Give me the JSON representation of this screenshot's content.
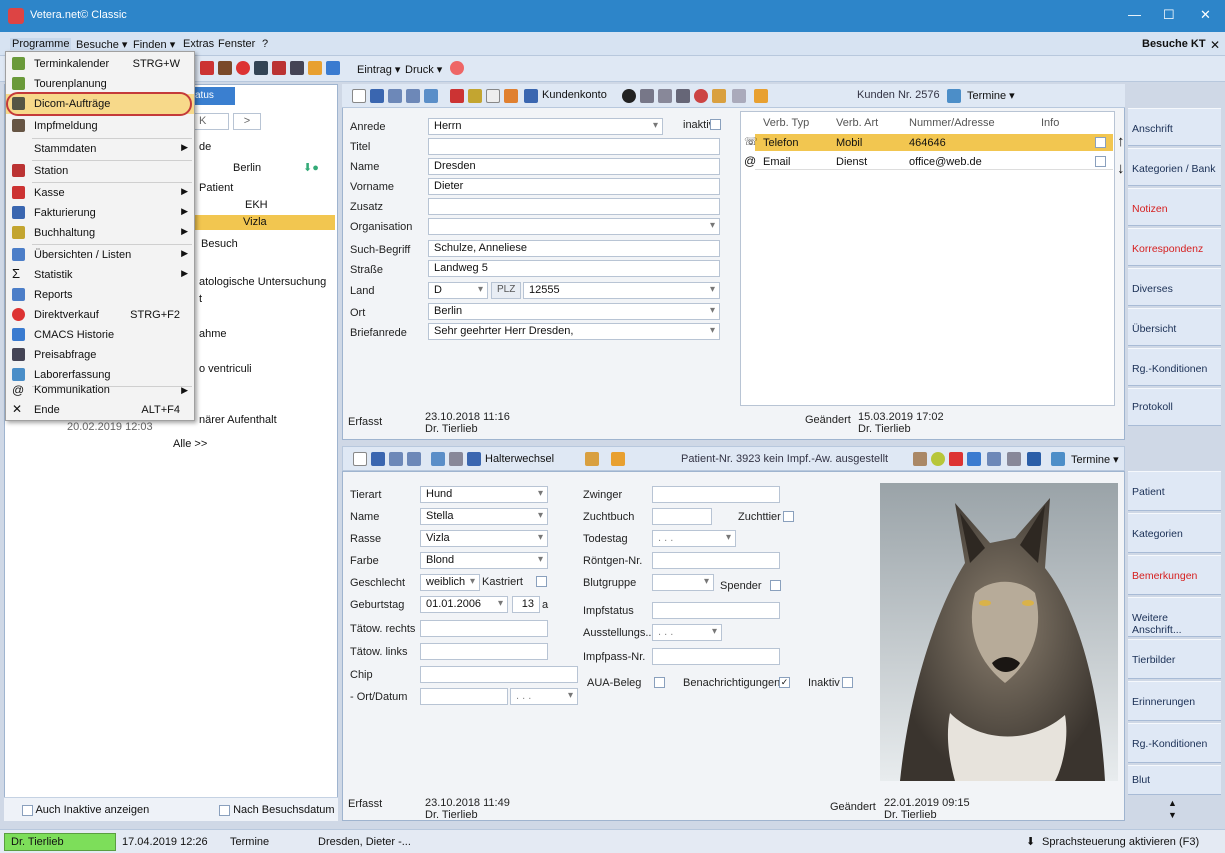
{
  "window": {
    "title": "Vetera.net© Classic"
  },
  "menubar": {
    "items": [
      "Programme",
      "Besuche ▾",
      "Finden ▾",
      "Extras",
      "Fenster",
      "?"
    ],
    "right_label": "Besuche KT"
  },
  "toolbar": {
    "eintrag": "Eintrag ▾",
    "druck": "Druck ▾"
  },
  "program_menu": {
    "items": [
      {
        "label": "Terminkalender",
        "shortcut": "STRG+W",
        "icon": "calendar-icon"
      },
      {
        "label": "Tourenplanung",
        "shortcut": "",
        "icon": "route-icon"
      },
      {
        "label": "Dicom-Aufträge",
        "shortcut": "",
        "icon": "dicom-icon",
        "highlighted": true
      },
      {
        "label": "Impfmeldung",
        "shortcut": "",
        "icon": "vaccine-icon"
      },
      {
        "label": "Stammdaten",
        "submenu": true
      },
      {
        "label": "Station",
        "icon": "station-icon"
      },
      {
        "label": "Kasse",
        "submenu": true,
        "icon": "cash-icon"
      },
      {
        "label": "Fakturierung",
        "submenu": true,
        "icon": "invoice-icon"
      },
      {
        "label": "Buchhaltung",
        "submenu": true,
        "icon": "accounting-icon"
      },
      {
        "label": "Übersichten / Listen",
        "submenu": true,
        "icon": "list-icon"
      },
      {
        "label": "Statistik",
        "submenu": true,
        "icon": "sigma-icon"
      },
      {
        "label": "Reports",
        "icon": "report-icon"
      },
      {
        "label": "Direktverkauf",
        "shortcut": "STRG+F2",
        "icon": "direct-sale-icon"
      },
      {
        "label": "CMACS Historie",
        "icon": "cloud-icon"
      },
      {
        "label": "Preisabfrage",
        "icon": "calculator-icon"
      },
      {
        "label": "Laborerfassung",
        "icon": "lab-icon"
      },
      {
        "label": "Kommunikation",
        "submenu": true,
        "icon": "at-icon"
      },
      {
        "label": "Ende",
        "shortcut": "ALT+F4",
        "icon": "close-icon"
      }
    ]
  },
  "left": {
    "tab": "atus",
    "nav_k": "K",
    "nav_next": ">",
    "rows": [
      "de",
      "Berlin",
      "Patient",
      "EKH",
      "Vizla",
      "Besuch",
      "atologische Untersuchung",
      "t",
      "ahme",
      "o ventriculi",
      "närer Aufenthalt",
      "20.02.2019 12:03",
      "Alle >>"
    ],
    "show_inactive": "Auch Inaktive anzeigen",
    "by_visit_date": "Nach Besuchsdatum"
  },
  "customer": {
    "kundenkonto": "Kundenkonto",
    "kunden_nr": "Kunden Nr. 2576",
    "termine": "Termine ▾",
    "fields": {
      "anrede": {
        "label": "Anrede",
        "value": "Herrn"
      },
      "inaktiv": "inaktiv",
      "titel": {
        "label": "Titel",
        "value": ""
      },
      "name": {
        "label": "Name",
        "value": "Dresden"
      },
      "vorname": {
        "label": "Vorname",
        "value": "Dieter"
      },
      "zusatz": {
        "label": "Zusatz",
        "value": ""
      },
      "organisation": {
        "label": "Organisation",
        "value": ""
      },
      "suchbegriff": {
        "label": "Such-Begriff",
        "value": "Schulze, Anneliese"
      },
      "strasse": {
        "label": "Straße",
        "value": "Landweg 5"
      },
      "land": {
        "label": "Land",
        "value": "D"
      },
      "plz_label": "PLZ",
      "plz": "12555",
      "ort": {
        "label": "Ort",
        "value": "Berlin"
      },
      "briefanrede": {
        "label": "Briefanrede",
        "value": "Sehr geehrter Herr Dresden,"
      }
    },
    "contacts": {
      "headers": [
        "Verb. Typ",
        "Verb. Art",
        "Nummer/Adresse",
        "Info"
      ],
      "rows": [
        {
          "typ": "Telefon",
          "art": "Mobil",
          "nummer": "464646",
          "selected": true
        },
        {
          "typ": "Email",
          "art": "Dienst",
          "nummer": "office@web.de",
          "selected": false
        }
      ]
    },
    "erfasst_label": "Erfasst",
    "erfasst": "23.10.2018 11:16",
    "erfasst_by": "Dr. Tierlieb",
    "geaendert_label": "Geändert",
    "geaendert": "15.03.2019 17:02",
    "geaendert_by": "Dr. Tierlieb"
  },
  "patient": {
    "halterwechsel": "Halterwechsel",
    "patient_nr": "Patient-Nr. 3923 kein Impf.-Aw. ausgestellt",
    "termine": "Termine ▾",
    "left_fields": [
      {
        "label": "Tierart",
        "value": "Hund"
      },
      {
        "label": "Name",
        "value": "Stella"
      },
      {
        "label": "Rasse",
        "value": "Vizla"
      },
      {
        "label": "Farbe",
        "value": "Blond"
      }
    ],
    "geschlecht_label": "Geschlecht",
    "geschlecht": "weiblich",
    "kastriert": "Kastriert",
    "geburtstag_label": "Geburtstag",
    "geburtstag": "01.01.2006",
    "alter": "13",
    "alter_unit": "a",
    "taetow_rechts": "Tätow. rechts",
    "taetow_links": "Tätow. links",
    "chip": "Chip",
    "ort_datum": "- Ort/Datum",
    "date_placeholder": ". . .",
    "right_fields": {
      "zwinger": "Zwinger",
      "zuchtbuch": "Zuchtbuch",
      "zuchttier": "Zuchttier",
      "todestag": "Todestag",
      "roentgen": "Röntgen-Nr.",
      "blutgruppe": "Blutgruppe",
      "spender": "Spender",
      "impfstatus": "Impfstatus",
      "ausstellung": "Ausstellungs..",
      "impfpass": "Impfpass-Nr.",
      "aua": "AUA-Beleg",
      "benachrichtigungen": "Benachrichtigungen",
      "inaktiv": "Inaktiv"
    },
    "erfasst_label": "Erfasst",
    "erfasst": "23.10.2018 11:49",
    "erfasst_by": "Dr. Tierlieb",
    "geaendert_label": "Geändert",
    "geaendert": "22.01.2019 09:15",
    "geaendert_by": "Dr. Tierlieb"
  },
  "right_nav_customer": [
    {
      "label": "Anschrift",
      "red": false
    },
    {
      "label": "Kategorien / Bank",
      "red": false
    },
    {
      "label": "Notizen",
      "red": true
    },
    {
      "label": "Korrespondenz",
      "red": true
    },
    {
      "label": "Diverses",
      "red": false
    },
    {
      "label": "Übersicht",
      "red": false
    },
    {
      "label": "Rg.-Konditionen",
      "red": false
    },
    {
      "label": "Protokoll",
      "red": false
    }
  ],
  "right_nav_patient": [
    {
      "label": "Patient",
      "red": false
    },
    {
      "label": "Kategorien",
      "red": false
    },
    {
      "label": "Bemerkungen",
      "red": true
    },
    {
      "label": "Weitere Anschrift...",
      "red": false
    },
    {
      "label": "Tierbilder",
      "red": false
    },
    {
      "label": "Erinnerungen",
      "red": false
    },
    {
      "label": "Rg.-Konditionen",
      "red": false
    },
    {
      "label": "Blut",
      "red": false
    }
  ],
  "statusbar": {
    "user": "Dr. Tierlieb",
    "datetime": "17.04.2019 12:26",
    "termine": "Termine",
    "customer": "Dresden, Dieter -...",
    "speech": "Sprachsteuerung aktivieren (F3)"
  },
  "colors": {
    "titlebar": "#2d85c9",
    "highlight": "#f2c650",
    "red_nav": "#d62020",
    "status_user_bg": "#7dde5a"
  }
}
